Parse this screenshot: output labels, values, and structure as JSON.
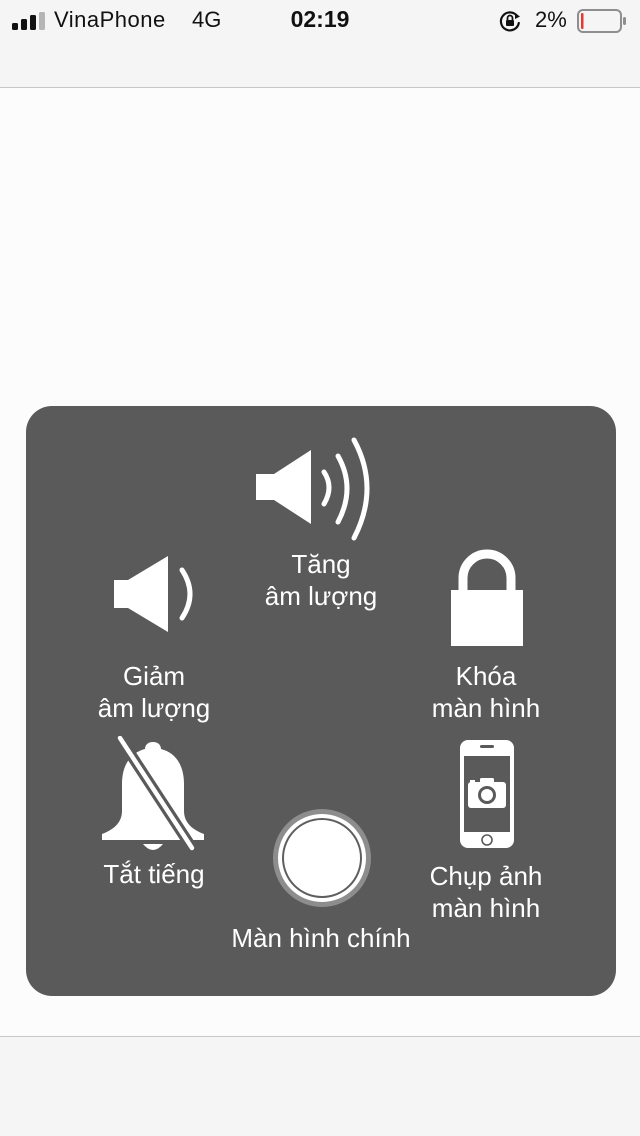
{
  "status_bar": {
    "carrier": "VinaPhone",
    "network": "4G",
    "time": "02:19",
    "battery_percent": "2%",
    "signal_bars": 3,
    "signal_bars_total": 4,
    "battery_level": 0.02,
    "battery_color": "#e53935",
    "icons": [
      "signal-icon",
      "rotation-lock-icon",
      "battery-icon"
    ]
  },
  "assistive_touch_menu": {
    "panel_color": "#5a5a5a",
    "items": {
      "volume_up": {
        "label": "Tăng\nâm lượng",
        "icon": "speaker-volume-up-icon"
      },
      "volume_down": {
        "label": "Giảm\nâm lượng",
        "icon": "speaker-volume-down-icon"
      },
      "lock_screen": {
        "label": "Khóa\nmàn hình",
        "icon": "lock-icon"
      },
      "mute": {
        "label": "Tắt tiếng",
        "icon": "bell-slash-icon"
      },
      "home": {
        "label": "Màn hình chính",
        "icon": "home-button-icon"
      },
      "screenshot": {
        "label": "Chụp ảnh\nmàn hình",
        "icon": "phone-camera-icon"
      }
    }
  }
}
